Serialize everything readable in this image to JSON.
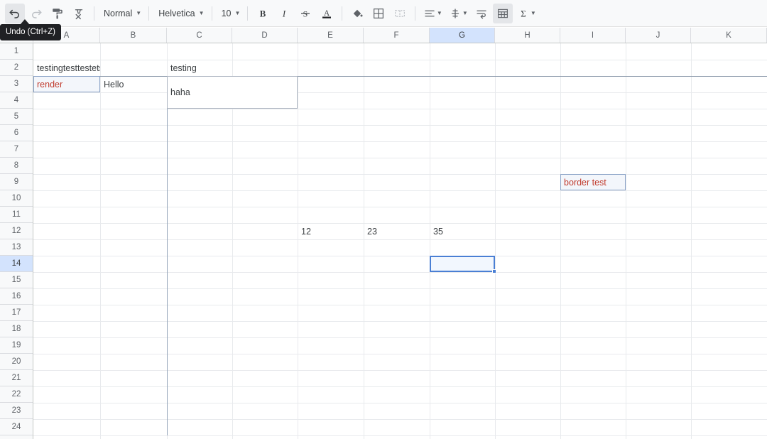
{
  "tooltip": {
    "text": "Undo (Ctrl+Z)"
  },
  "toolbar": {
    "buttons": [
      {
        "name": "undo-icon",
        "label": "Undo",
        "state": "active"
      },
      {
        "name": "redo-icon",
        "label": "Redo",
        "state": "disabled"
      },
      {
        "name": "paint-format-icon",
        "label": "Paint format",
        "state": "normal"
      },
      {
        "name": "clear-formatting-icon",
        "label": "Clear formatting",
        "state": "normal"
      }
    ],
    "style_dropdown": {
      "name": "text-style-select",
      "value": "Normal"
    },
    "font_dropdown": {
      "name": "font-family-select",
      "value": "Helvetica"
    },
    "size_dropdown": {
      "name": "font-size-select",
      "value": "10"
    },
    "format_buttons": [
      {
        "name": "bold-icon",
        "label": "Bold"
      },
      {
        "name": "italic-icon",
        "label": "Italic"
      },
      {
        "name": "strikethrough-icon",
        "label": "Strikethrough"
      },
      {
        "name": "text-color-icon",
        "label": "Text color"
      }
    ],
    "fill_buttons": [
      {
        "name": "fill-color-icon",
        "label": "Fill color"
      },
      {
        "name": "borders-icon",
        "label": "Borders"
      },
      {
        "name": "merge-cells-icon",
        "label": "Merge cells"
      }
    ],
    "align_buttons": [
      {
        "name": "horizontal-align-icon",
        "label": "Horizontal align"
      },
      {
        "name": "vertical-align-icon",
        "label": "Vertical align"
      },
      {
        "name": "text-wrapping-icon",
        "label": "Text wrapping"
      }
    ],
    "right_buttons": [
      {
        "name": "insert-table-icon",
        "label": "Insert table",
        "state": "active"
      },
      {
        "name": "functions-icon",
        "label": "Functions",
        "state": "normal"
      }
    ]
  },
  "grid": {
    "columns": [
      "A",
      "B",
      "C",
      "D",
      "E",
      "F",
      "G",
      "H",
      "I",
      "J",
      "K"
    ],
    "selected_column": "G",
    "rows": [
      "1",
      "2",
      "3",
      "4",
      "5",
      "6",
      "7",
      "8",
      "9",
      "10",
      "11",
      "12",
      "13",
      "14",
      "15",
      "16",
      "17",
      "18",
      "19",
      "20",
      "21",
      "22",
      "23",
      "24"
    ],
    "selected_row": "14",
    "selected_cell": "G14",
    "cells": [
      {
        "ref": "A2",
        "value": "testingtesttestets",
        "align": "left",
        "color": "#3c4043"
      },
      {
        "ref": "C2",
        "value": "testing",
        "align": "left",
        "color": "#3c4043"
      },
      {
        "ref": "B3",
        "value": "Hello",
        "align": "left",
        "color": "#3c4043"
      },
      {
        "ref": "E12",
        "value": "12",
        "align": "left",
        "color": "#3c4043"
      },
      {
        "ref": "F12",
        "value": "23",
        "align": "left",
        "color": "#3c4043"
      },
      {
        "ref": "G12",
        "value": "35",
        "align": "left",
        "color": "#3c4043"
      }
    ],
    "styled_cells": [
      {
        "ref": "A3",
        "value": "render",
        "text_color": "#c0392b",
        "border_color": "#8ba3c7",
        "fill": "#f3f6fb"
      },
      {
        "ref": "I9",
        "value": "border test",
        "text_color": "#c0392b",
        "border_color": "#8ba3c7",
        "fill": "#f3f6fb"
      }
    ],
    "merged_cells": [
      {
        "ref": "C3:D4",
        "value": "haha",
        "border_color": "#aeb6c2"
      }
    ]
  },
  "colors": {
    "selection_border": "#4a7fd4",
    "header_selected": "#d3e3fd",
    "gridline": "#e8eaed",
    "applied_border": "#8c9aab"
  }
}
